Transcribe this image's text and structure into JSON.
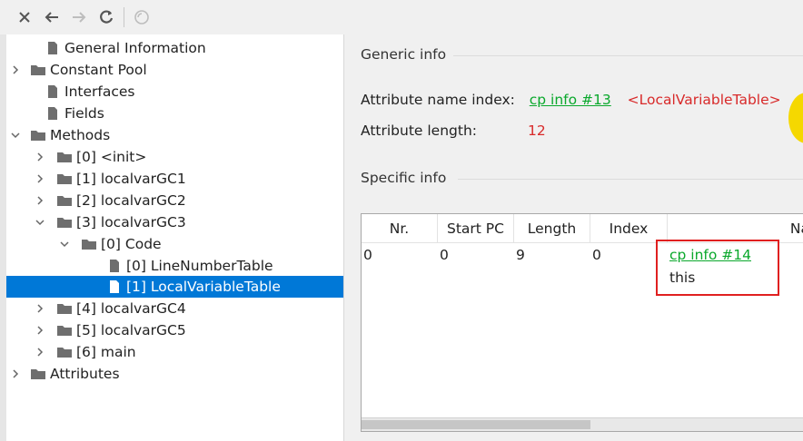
{
  "toolbar": {
    "buttons": [
      {
        "name": "close-icon"
      },
      {
        "name": "back-arrow-icon"
      },
      {
        "name": "forward-arrow-icon"
      },
      {
        "name": "refresh-icon"
      },
      {
        "name": "browse-icon"
      }
    ]
  },
  "tree": {
    "general_info": "General Information",
    "constant_pool": "Constant Pool",
    "interfaces": "Interfaces",
    "fields": "Fields",
    "methods": "Methods",
    "m0": "[0] <init>",
    "m1": "[1] localvarGC1",
    "m2": "[2] localvarGC2",
    "m3": "[3] localvarGC3",
    "m3_code": "[0] Code",
    "m3_code_lnt": "[0] LineNumberTable",
    "m3_code_lvt": "[1] LocalVariableTable",
    "m4": "[4] localvarGC4",
    "m5": "[5] localvarGC5",
    "m6": "[6] main",
    "attributes": "Attributes"
  },
  "detail": {
    "generic_heading": "Generic info",
    "attr_name_label": "Attribute name index:",
    "attr_name_link": "cp info #13",
    "attr_name_value": "<LocalVariableTable>",
    "attr_len_label": "Attribute length:",
    "attr_len_value": "12",
    "specific_heading": "Specific info"
  },
  "table": {
    "columns": [
      "Nr.",
      "Start PC",
      "Length",
      "Index",
      "Na"
    ],
    "row": {
      "nr": "0",
      "start_pc": "0",
      "length": "9",
      "index": "0",
      "name_link": "cp info #14",
      "name_value": "this"
    }
  },
  "colors": {
    "selection": "#0078d7",
    "link": "#0aa82c",
    "value_red": "#d82a2a",
    "highlight_box": "#e02020"
  }
}
